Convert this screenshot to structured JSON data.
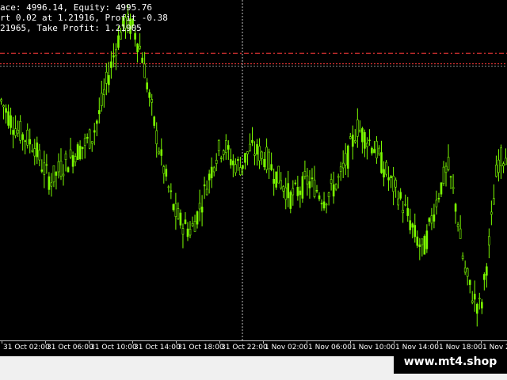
{
  "info": {
    "line1": "ace: 4996.14, Equity: 4995.76",
    "line2": "rt 0.02 at 1.21916, Profit -0.38",
    "line3": "21965, Take Profit: 1.21905"
  },
  "colors": {
    "background": "#000000",
    "bull_candle": "#7CFC00",
    "stop_loss_line": "#ff3b3b",
    "take_profit_line": "#ff3b3b",
    "cursor_line": "#c0c0c0",
    "text": "#ffffff"
  },
  "x_axis": {
    "labels": [
      "31 Oct 02:00",
      "31 Oct 06:00",
      "31 Oct 10:00",
      "31 Oct 14:00",
      "31 Oct 18:00",
      "31 Oct 22:00",
      "1 Nov 02:00",
      "1 Nov 06:00",
      "1 Nov 10:00",
      "1 Nov 14:00",
      "1 Nov 18:00",
      "1 Nov 2"
    ]
  },
  "watermark": "www.mt4.shop",
  "chart_data": {
    "type": "line",
    "series": [
      {
        "values": [
          1.2195,
          1.2186,
          1.2178,
          1.2174,
          1.217,
          1.2158,
          1.215,
          1.2156,
          1.2161,
          1.2166,
          1.217,
          1.2175,
          1.219,
          1.221,
          1.2228,
          1.224,
          1.2236,
          1.2222,
          1.2195,
          1.217,
          1.215,
          1.2132,
          1.2125,
          1.2122,
          1.2135,
          1.215,
          1.2165,
          1.217,
          1.216,
          1.2158,
          1.2168,
          1.2166,
          1.2163,
          1.2155,
          1.2148,
          1.2141,
          1.2145,
          1.215,
          1.2146,
          1.214,
          1.2145,
          1.2152,
          1.2165,
          1.218,
          1.2175,
          1.217,
          1.216,
          1.215,
          1.2142,
          1.2132,
          1.212,
          1.211,
          1.2128,
          1.2145,
          1.2158,
          1.2135,
          1.21,
          1.2085,
          1.2078,
          1.2115,
          1.216,
          1.2165
        ]
      }
    ],
    "y_range": [
      1.206,
      1.2252
    ],
    "horizontal_lines": [
      1.2222,
      1.2216
    ],
    "cursor_x_fraction": 0.478,
    "grid": false
  }
}
